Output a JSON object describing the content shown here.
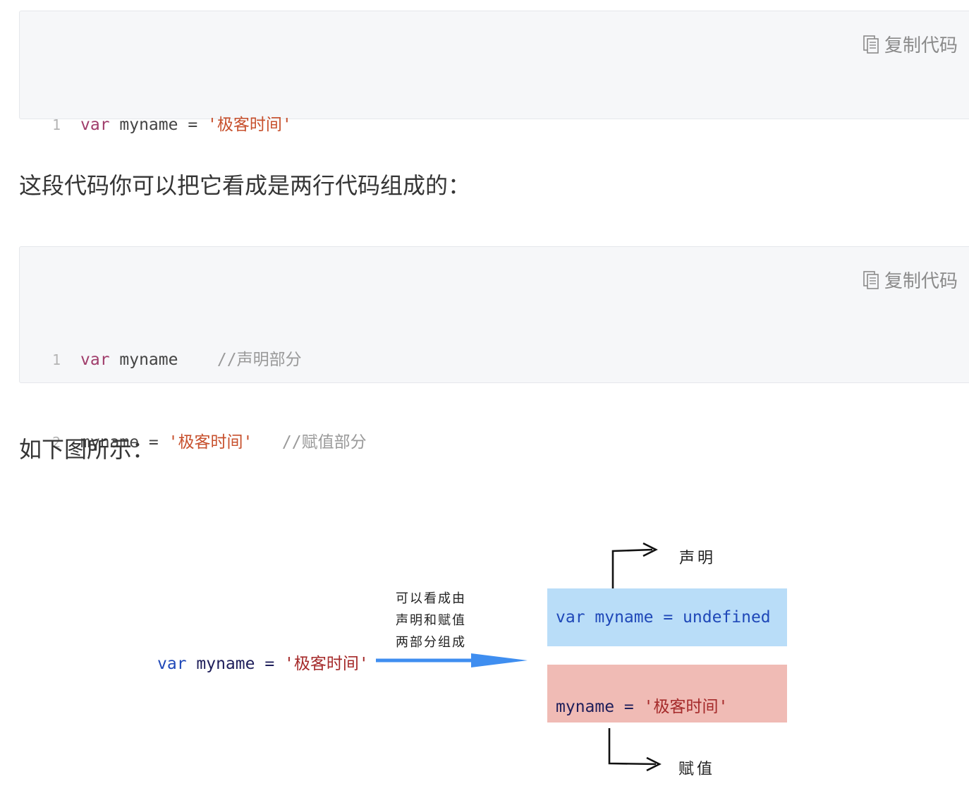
{
  "code_block_1": {
    "copy_label": "复制代码",
    "lines": [
      {
        "num": "1",
        "kw": "var",
        "name": " myname = ",
        "str": "'极客时间'"
      }
    ]
  },
  "paragraph_1": "这段代码你可以把它看成是两行代码组成的：",
  "code_block_2": {
    "copy_label": "复制代码",
    "lines": [
      {
        "num": "1",
        "kw": "var",
        "name": " myname    ",
        "comment": "//声明部分"
      },
      {
        "num": "2",
        "name": "myname = ",
        "str": "'极客时间'",
        "comment": "   //赋值部分"
      }
    ]
  },
  "paragraph_2": "如下图所示：",
  "diagram": {
    "source": {
      "kw": "var",
      "name": " myname = ",
      "str": "'极客时间'"
    },
    "arrow_note": [
      "可以看成由",
      "声明和赋值",
      "两部分组成"
    ],
    "declaration_box": {
      "kw": "var",
      "name": " myname = ",
      "value": "undefined"
    },
    "assignment_box": {
      "name": "myname = ",
      "str": "'极客时间'"
    },
    "declaration_label": "声明",
    "assignment_label": "赋值",
    "colors": {
      "declaration_box": "#b9ddf8",
      "assignment_box": "#f0bbb5",
      "arrow": "#3f8ef0"
    }
  }
}
